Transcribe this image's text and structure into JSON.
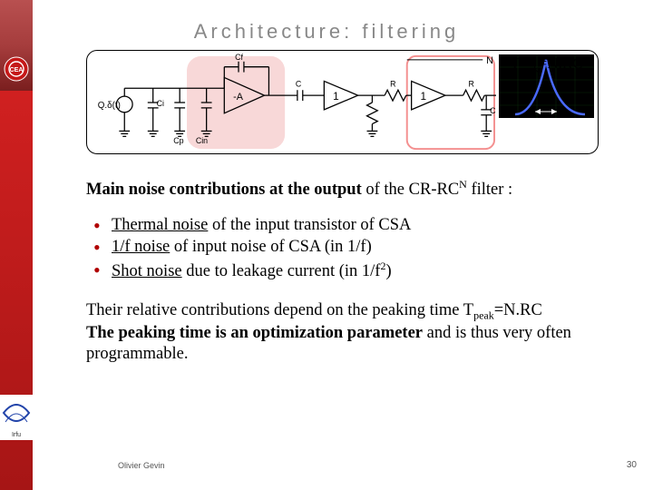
{
  "title": "Architecture: filtering",
  "peak_label_html": "T<sub>peak</sub>=N.RC",
  "intro_html": "<b>Main noise contributions at the output</b> of the CR-RC<sup>N</sup> filter :",
  "bullets": [
    {
      "html": "<u>Thermal noise</u> of the input transistor of CSA"
    },
    {
      "html": "<u>1/f noise</u> of input noise of CSA (in 1/f)"
    },
    {
      "html": "<u>Shot noise</u> due to leakage current (in 1/f<sup>2</sup>)"
    }
  ],
  "para2_html": "Their relative contributions depend on the peaking time T<sub>peak</sub>=N.RC<br><b>The peaking time is an optimization parameter</b> and is thus very often programmable.",
  "author": "Olivier Gevin",
  "page_number": "30",
  "circuit_labels": {
    "q": "Q.δ(t)",
    "ci": "Ci",
    "cin": "Cin",
    "cp": "Cp",
    "cf": "Cf",
    "a_neg": "-A",
    "c": "C",
    "r": "R",
    "one": "1",
    "n": "N"
  },
  "logos": {
    "top": "CEA",
    "bottom": "Irfu"
  }
}
